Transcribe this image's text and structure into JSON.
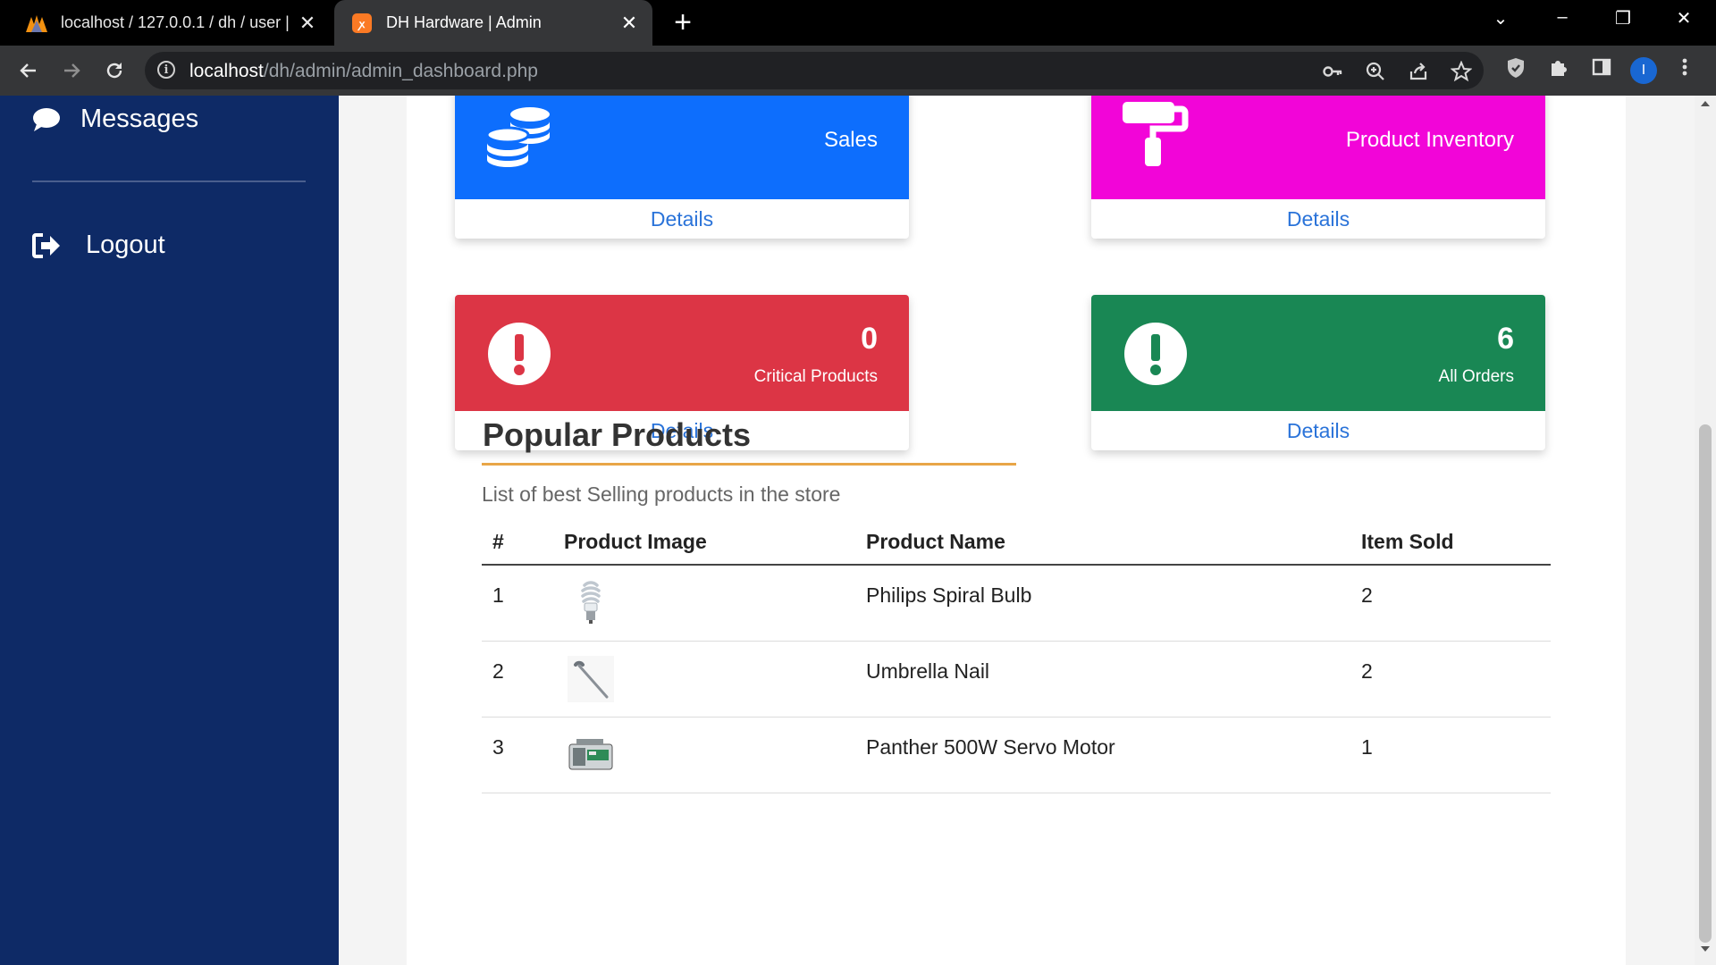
{
  "browser": {
    "tabs": [
      {
        "title": "localhost / 127.0.0.1 / dh / user |",
        "close": "✕"
      },
      {
        "title": "DH Hardware | Admin",
        "close": "✕"
      }
    ],
    "new_tab": "+",
    "url_host": "localhost",
    "url_path": "/dh/admin/admin_dashboard.php",
    "window_controls": {
      "minimize": "–",
      "restore": "❐",
      "close": "✕",
      "tab_search": "⌄"
    },
    "profile_initial": "I"
  },
  "sidebar": {
    "items": [
      {
        "label": "Messages",
        "icon": "comment-icon"
      },
      {
        "label": "Logout",
        "icon": "sign-out-icon"
      }
    ]
  },
  "cards": [
    {
      "label": "Sales",
      "link": "Details",
      "color": "#0d6efd",
      "icon": "coins-icon"
    },
    {
      "label": "Product Inventory",
      "link": "Details",
      "color": "#f205d8",
      "icon": "paint-roller-icon"
    },
    {
      "value": "0",
      "label": "Critical Products",
      "link": "Details",
      "color": "#dc3545",
      "icon": "exclamation-circle-icon"
    },
    {
      "value": "6",
      "label": "All Orders",
      "link": "Details",
      "color": "#198754",
      "icon": "exclamation-circle-icon"
    }
  ],
  "popular": {
    "title": "Popular Products",
    "subtitle": "List of best Selling products in the store",
    "columns": [
      "#",
      "Product Image",
      "Product Name",
      "Item Sold"
    ],
    "rows": [
      {
        "num": "1",
        "name": "Philips Spiral Bulb",
        "sold": "2",
        "image": "spiral-bulb-image"
      },
      {
        "num": "2",
        "name": "Umbrella Nail",
        "sold": "2",
        "image": "umbrella-nail-image"
      },
      {
        "num": "3",
        "name": "Panther 500W Servo Motor",
        "sold": "1",
        "image": "servo-motor-image"
      }
    ]
  }
}
